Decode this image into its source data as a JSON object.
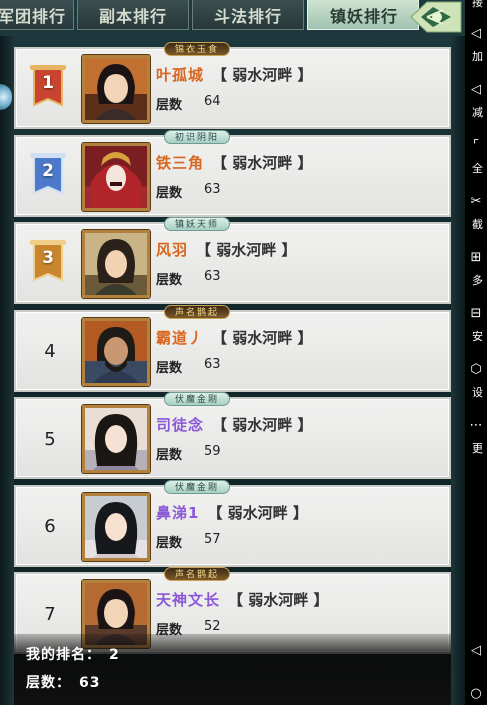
{
  "tabs": [
    {
      "label": "军团排行"
    },
    {
      "label": "副本排行"
    },
    {
      "label": "斗法排行"
    },
    {
      "label": "镇妖排行",
      "active": true
    }
  ],
  "rows": [
    {
      "rank": "1",
      "badge": "锦衣玉食",
      "name": "叶孤城",
      "server": "【 弱水河畔 】",
      "floor_label": "层数",
      "floor": "64",
      "name_color": "orange"
    },
    {
      "rank": "2",
      "badge": "初识阴阳",
      "name": "铁三角",
      "server": "【 弱水河畔 】",
      "floor_label": "层数",
      "floor": "63",
      "name_color": "orange"
    },
    {
      "rank": "3",
      "badge": "镇妖天师",
      "name": "风羽",
      "server": "【 弱水河畔 】",
      "floor_label": "层数",
      "floor": "63",
      "name_color": "orange"
    },
    {
      "rank": "4",
      "badge": "声名鹊起",
      "name": "霸道丿",
      "server": "【 弱水河畔 】",
      "floor_label": "层数",
      "floor": "63",
      "name_color": "orange"
    },
    {
      "rank": "5",
      "badge": "伏魔金刚",
      "name": "司徒念",
      "server": "【 弱水河畔 】",
      "floor_label": "层数",
      "floor": "59",
      "name_color": "purple"
    },
    {
      "rank": "6",
      "badge": "伏魔金刚",
      "name": "鼻涕1",
      "server": "【 弱水河畔 】",
      "floor_label": "层数",
      "floor": "57",
      "name_color": "purple"
    },
    {
      "rank": "7",
      "badge": "声名鹊起",
      "name": "天神文长",
      "server": "【 弱水河畔 】",
      "floor_label": "层数",
      "floor": "52",
      "name_color": "purple"
    }
  ],
  "mine": {
    "rank_label": "我的排名：",
    "rank": "2",
    "floor_label": "层数：",
    "floor": "63"
  },
  "toolbar": [
    {
      "icon": "back-icon",
      "label": "接"
    },
    {
      "icon": "volume-up-icon",
      "label": "加"
    },
    {
      "icon": "volume-down-icon",
      "label": "减"
    },
    {
      "icon": "fullscreen-icon",
      "label": "全"
    },
    {
      "icon": "scissors-icon",
      "label": "截"
    },
    {
      "icon": "multi-open-icon",
      "label": "多"
    },
    {
      "icon": "install-icon",
      "label": "安"
    },
    {
      "icon": "settings-icon",
      "label": "设"
    },
    {
      "icon": "more-icon",
      "label": "更"
    }
  ],
  "colors": {
    "orange_name": "#d8661e",
    "purple_name": "#8b58d8",
    "rank1": "#c9442f",
    "rank2": "#4c79c9",
    "rank3": "#c9862f"
  }
}
